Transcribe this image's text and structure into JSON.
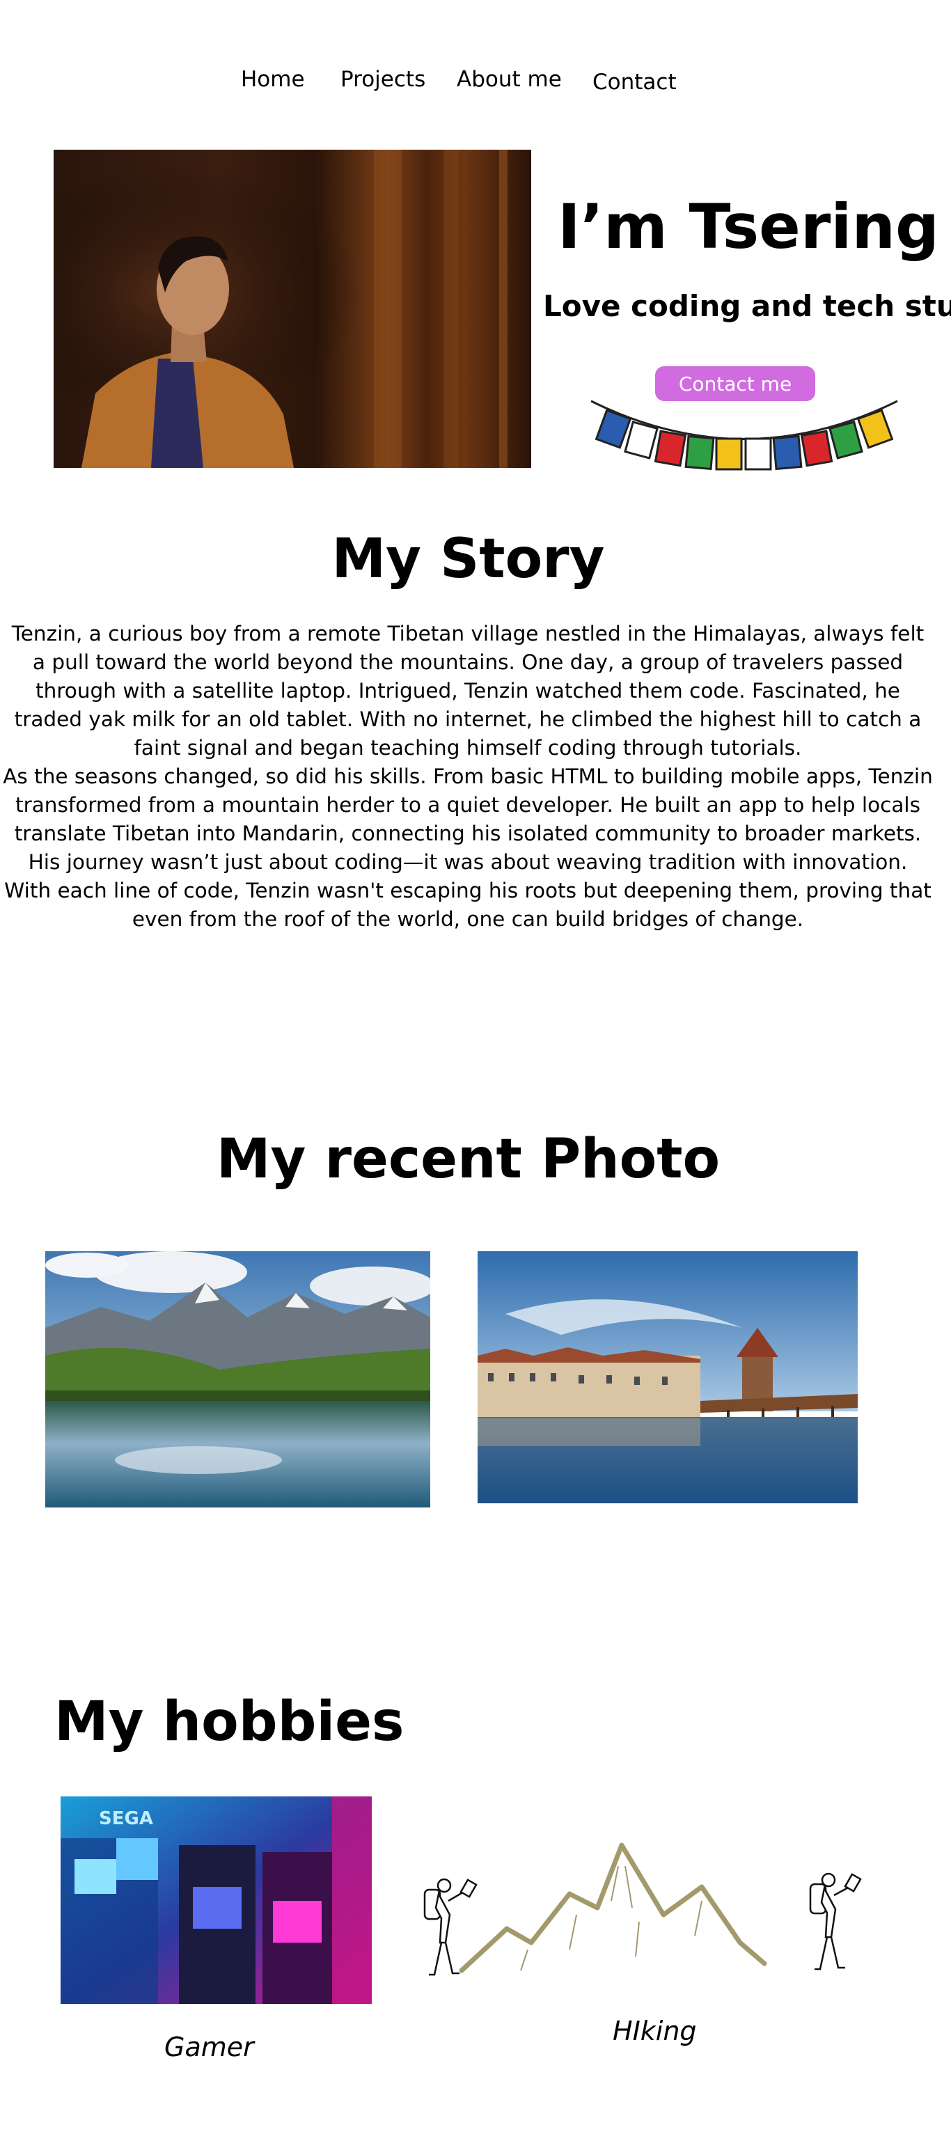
{
  "nav": {
    "items": [
      "Home",
      "Projects",
      "About me",
      "Contact"
    ]
  },
  "hero": {
    "title": "I’m Tsering",
    "subtitle": "Love coding and tech stuffs",
    "contact_button": "Contact me",
    "image_icon": "portrait-photo",
    "decoration_icon": "prayer-flags-icon"
  },
  "story": {
    "title": "My Story",
    "paragraph1": "Tenzin, a curious boy from a remote Tibetan village nestled in the Himalayas, always felt a pull toward the world beyond the mountains. One day, a group of travelers passed through with a satellite laptop. Intrigued, Tenzin watched them code. Fascinated, he traded yak milk for an old tablet. With no internet, he climbed the highest hill to catch a faint signal and began teaching himself coding through tutorials.",
    "paragraph2": "As the seasons changed, so did his skills. From basic HTML to building mobile apps, Tenzin transformed from a mountain herder to a quiet developer. He built an app to help locals translate Tibetan into Mandarin, connecting his isolated community to broader markets. His journey wasn’t just about coding—it was about weaving tradition with innovation. With each line of code, Tenzin wasn't escaping his roots but deepening them, proving that even from the roof of the world, one can build bridges of change."
  },
  "photos": {
    "title": "My recent Photo",
    "items": [
      "mountain-lake-photo",
      "lakeside-town-photo"
    ]
  },
  "hobbies": {
    "title": "My hobbies",
    "items": [
      {
        "caption": "Gamer",
        "icon": "arcade-photo"
      },
      {
        "caption": "HIking",
        "icon": "hiking-illustration"
      }
    ]
  },
  "colors": {
    "button": "#d16be0",
    "flags": [
      "#2a5db0",
      "#ffffff",
      "#d8262a",
      "#2ea043",
      "#f2c21b"
    ]
  }
}
